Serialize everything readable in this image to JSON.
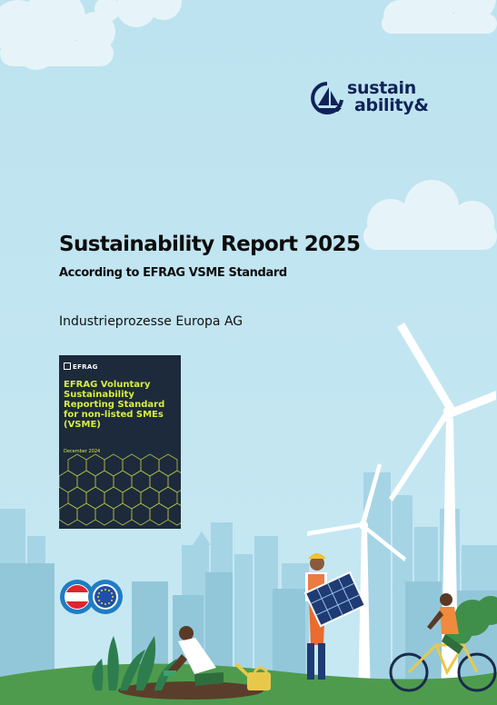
{
  "logo": {
    "line1": "sustain",
    "line2": "ability&",
    "icon": "sailboat-icon"
  },
  "report": {
    "title": "Sustainability Report 2025",
    "subtitle": "According to EFRAG VSME Standard",
    "company": "Industrieprozesse Europa AG"
  },
  "cover_image": {
    "brand": "EFRAG",
    "title": "EFRAG Voluntary Sustainability Reporting Standard for non-listed SMEs (VSME)",
    "date": "December 2024"
  },
  "colors": {
    "sky": "#bfe4f0",
    "navy": "#0f2357",
    "cover_bg": "#1d2a3b",
    "cover_accent": "#d7ef3e",
    "grass": "#4e9b4e"
  }
}
